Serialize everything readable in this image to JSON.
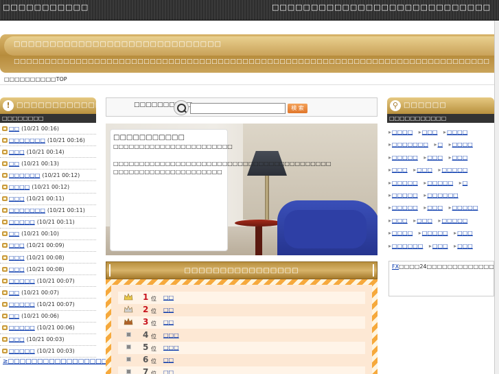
{
  "header": {
    "site_title": "□□□□□□□□□□□",
    "tagline": "□□□□□□□□□□□□□□□□□□□□□□□□□□□□"
  },
  "banner": {
    "headline": "□□□□□□□□□□□□□□□□□□□□□□□□□□□□□",
    "subline": "□□□□□□□□□□□□□□□□□□□□□□□□□□□□□□□□□□□□□□□□□□□□□□□□□□□□□□□□□□□□□□□□□□□□□□□□□□□□□"
  },
  "breadcrumb": "□□□□□□□□□□TOP",
  "left": {
    "header": "□□□□□□□□□□□□□□□□",
    "subheader": "□□□□□□□□",
    "items": [
      {
        "label": "□□",
        "time": "(10/21 00:16)"
      },
      {
        "label": "□□□□□□□",
        "time": "(10/21 00:16)"
      },
      {
        "label": "□□□",
        "time": "(10/21 00:14)"
      },
      {
        "label": "□□",
        "time": "(10/21 00:13)"
      },
      {
        "label": "□□□□□□",
        "time": "(10/21 00:12)"
      },
      {
        "label": "□□□□",
        "time": "(10/21 00:12)"
      },
      {
        "label": "□□□",
        "time": "(10/21 00:11)"
      },
      {
        "label": "□□□□□□□",
        "time": "(10/21 00:11)"
      },
      {
        "label": "□□□□□",
        "time": "(10/21 00:11)"
      },
      {
        "label": "□□",
        "time": "(10/21 00:10)"
      },
      {
        "label": "□□□",
        "time": "(10/21 00:09)"
      },
      {
        "label": "□□□",
        "time": "(10/21 00:08)"
      },
      {
        "label": "□□□",
        "time": "(10/21 00:08)"
      },
      {
        "label": "□□□□□",
        "time": "(10/21 00:07)"
      },
      {
        "label": "□□",
        "time": "(10/21 00:07)"
      },
      {
        "label": "□□□□□",
        "time": "(10/21 00:07)"
      },
      {
        "label": "□□",
        "time": "(10/21 00:06)"
      },
      {
        "label": "□□□□□",
        "time": "(10/21 00:06)"
      },
      {
        "label": "□□□",
        "time": "(10/21 00:03)"
      },
      {
        "label": "□□□□□",
        "time": "(10/21 00:03)"
      }
    ],
    "more_link": "≥□□□□□□□□□□□□□□□□□□□□□□□□□"
  },
  "search": {
    "label": "□□□□□□□□□□",
    "placeholder": "",
    "button": "検 索"
  },
  "hero": {
    "title": "□□□□□□□□□□□",
    "subtitle": "□□□□□□□□□□□□□□□□□□□□□□□",
    "body1": "□□□□□□□□□□□□□□□□□□□□□□□□□□□□□□□□□□□□□□□□□□",
    "body2": "□□□□□□□□□□□□□□□□□□□□□"
  },
  "ranking": {
    "header": "□□□□□□□□□□□□□□□□",
    "pos_suffix": "位",
    "rows": [
      {
        "num": "1",
        "label": "□□",
        "medal": "gold"
      },
      {
        "num": "2",
        "label": "□□",
        "medal": "silver"
      },
      {
        "num": "3",
        "label": "□□",
        "medal": "bronze"
      },
      {
        "num": "4",
        "label": "□□□",
        "medal": "none"
      },
      {
        "num": "5",
        "label": "□□□",
        "medal": "none"
      },
      {
        "num": "6",
        "label": "□□",
        "medal": "none"
      },
      {
        "num": "7",
        "label": "□□",
        "medal": "none"
      }
    ]
  },
  "right": {
    "header": "□□□□□□",
    "subheader": "□□□□□□□□□□□",
    "tags": [
      "□□□□",
      "□□□",
      "□□□□",
      "□□□□□□□",
      "□",
      "□□□□",
      "□□□□□",
      "□□□",
      "□□□",
      "□□□",
      "□□□",
      "□□□□□",
      "□□□□□",
      "□□□□□",
      "□",
      "□□□□□",
      "□□□□□□",
      "□□□□□",
      "□□□",
      "□□□□□",
      "□□□",
      "□□□",
      "□□□□□",
      "□□□□",
      "□□□□□",
      "□□□",
      "□□□□□□",
      "□□□",
      "□□□",
      "□□□□□□",
      "□□",
      "□□□□□",
      "□□□□□",
      "□□□□□",
      "□□□□",
      "□□□□□",
      "□□□",
      "□□□□□",
      "□□□□□",
      "□□□□",
      "□□…",
      "□□□□□",
      "□□□□□",
      "□□□□□"
    ],
    "fx_link": "FX",
    "fx_text": "□□□□24□□□□□□□□□□□□□□□□□□□□□□□□□□□□□□□□□□□□□□□□□□□□□□□□□□□□□□□□□□□□□□□□□□□□□□□□□□□□□□□□□"
  },
  "colors": {
    "gold": "#c9a259",
    "link": "#0033aa",
    "rank_red": "#c8141e",
    "orange_stripe": "#f6a93c",
    "topbar": "#333333"
  }
}
